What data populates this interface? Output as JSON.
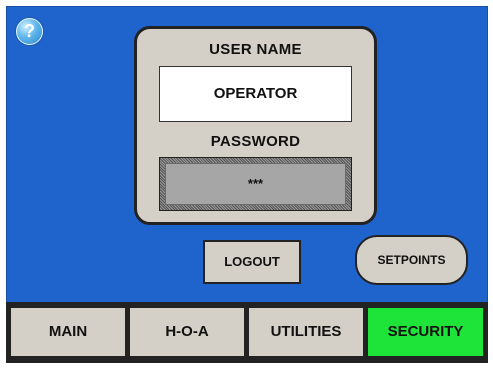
{
  "help": {
    "icon": "question-mark-icon",
    "glyph": "?"
  },
  "login": {
    "username_label": "USER NAME",
    "username_value": "OPERATOR",
    "password_label": "PASSWORD",
    "password_value": "***"
  },
  "buttons": {
    "logout_label": "LOGOUT",
    "setpoints_label": "SETPOINTS"
  },
  "tabs": [
    {
      "label": "MAIN"
    },
    {
      "label": "H-O-A"
    },
    {
      "label": "UTILITIES"
    },
    {
      "label": "SECURITY",
      "active": true
    }
  ],
  "colors": {
    "screen_background": "#1f63cc",
    "panel_background": "#d4d0c8",
    "active_tab": "#1ee43a"
  }
}
